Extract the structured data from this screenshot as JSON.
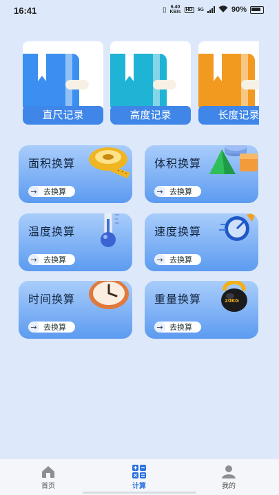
{
  "status_bar": {
    "time": "16:41",
    "net_speed": "6.40",
    "net_unit": "KB/s",
    "hd": "HD",
    "network": "5G",
    "battery": "90%"
  },
  "record_cards": [
    {
      "label": "直尺记录",
      "color": "#3a8ff0"
    },
    {
      "label": "高度记录",
      "color": "#1fb3d6"
    },
    {
      "label": "长度记录",
      "color": "#f29a1f"
    }
  ],
  "converters": [
    {
      "title": "面积换算",
      "button": "去换算",
      "icon": "tape-measure-icon"
    },
    {
      "title": "体积换算",
      "button": "去换算",
      "icon": "shapes-3d-icon"
    },
    {
      "title": "温度换算",
      "button": "去换算",
      "icon": "thermometer-icon"
    },
    {
      "title": "速度换算",
      "button": "去换算",
      "icon": "speed-compass-icon"
    },
    {
      "title": "时间换算",
      "button": "去换算",
      "icon": "clock-icon"
    },
    {
      "title": "重量换算",
      "button": "去换算",
      "icon": "kettlebell-icon"
    }
  ],
  "kettlebell_text": "20KG",
  "nav": {
    "home": "首页",
    "calc": "计算",
    "mine": "我的",
    "active": "calc"
  }
}
